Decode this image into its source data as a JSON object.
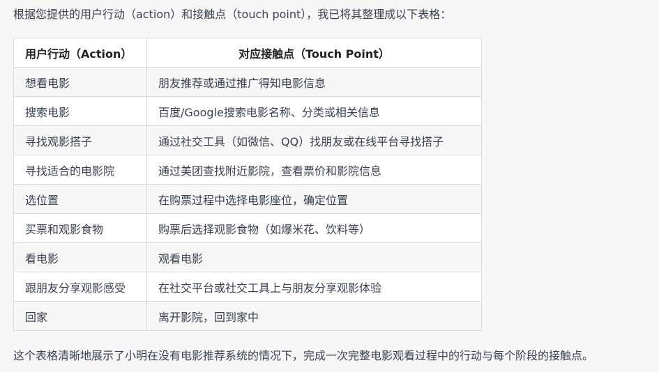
{
  "intro": "根据您提供的用户行动（action）和接触点（touch point），我已将其整理成以下表格：",
  "table": {
    "headers": [
      "用户行动（Action）",
      "对应接触点（Touch Point）"
    ],
    "rows": [
      [
        "想看电影",
        "朋友推荐或通过推广得知电影信息"
      ],
      [
        "搜索电影",
        "百度/Google搜索电影名称、分类或相关信息"
      ],
      [
        "寻找观影搭子",
        "通过社交工具（如微信、QQ）找朋友或在线平台寻找搭子"
      ],
      [
        "寻找适合的电影院",
        "通过美团查找附近影院，查看票价和影院信息"
      ],
      [
        "选位置",
        "在购票过程中选择电影座位，确定位置"
      ],
      [
        "买票和观影食物",
        "购票后选择观影食物（如爆米花、饮料等）"
      ],
      [
        "看电影",
        "观看电影"
      ],
      [
        "跟朋友分享观影感受",
        "在社交平台或社交工具上与朋友分享观影体验"
      ],
      [
        "回家",
        "离开影院，回到家中"
      ]
    ]
  },
  "summary": "这个表格清晰地展示了小明在没有电影推荐系统的情况下，完成一次完整电影观看过程中的行动与每个阶段的接触点。"
}
